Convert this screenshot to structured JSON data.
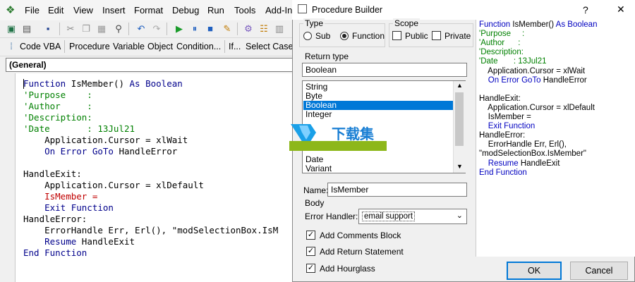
{
  "menubar": [
    "File",
    "Edit",
    "View",
    "Insert",
    "Format",
    "Debug",
    "Run",
    "Tools",
    "Add-In"
  ],
  "toolbar2": {
    "code_vba": "Code VBA",
    "procedure": "Procedure",
    "variable": "Variable",
    "object": "Object",
    "condition": "Condition...",
    "if": "If...",
    "select_case": "Select Case..."
  },
  "object_combo": "(General)",
  "code_lines": [
    {
      "parts": [
        [
          "kw",
          "Function "
        ],
        [
          "bk",
          "IsMember() "
        ],
        [
          "kw",
          "As Boolean"
        ]
      ]
    },
    {
      "parts": [
        [
          "cm",
          "'Purpose    :"
        ]
      ]
    },
    {
      "parts": [
        [
          "cm",
          "'Author     :"
        ]
      ]
    },
    {
      "parts": [
        [
          "cm",
          "'Description:"
        ]
      ]
    },
    {
      "parts": [
        [
          "cm",
          "'Date       : 13Jul21"
        ]
      ]
    },
    {
      "parts": [
        [
          "bk",
          "    Application.Cursor = xlWait"
        ]
      ]
    },
    {
      "parts": [
        [
          "kw",
          "    On Error GoTo "
        ],
        [
          "bk",
          "HandleError"
        ]
      ]
    },
    {
      "parts": [
        [
          "bk",
          ""
        ]
      ]
    },
    {
      "parts": [
        [
          "bk",
          "HandleExit:"
        ]
      ]
    },
    {
      "parts": [
        [
          "bk",
          "    Application.Cursor = xlDefault"
        ]
      ]
    },
    {
      "parts": [
        [
          "rd",
          "    IsMember ="
        ]
      ]
    },
    {
      "parts": [
        [
          "kw",
          "    Exit Function"
        ]
      ]
    },
    {
      "parts": [
        [
          "bk",
          "HandleError:"
        ]
      ]
    },
    {
      "parts": [
        [
          "bk",
          "    ErrorHandle Err, Erl(), \"modSelectionBox.IsM"
        ]
      ]
    },
    {
      "parts": [
        [
          "kw",
          "    Resume "
        ],
        [
          "bk",
          "HandleExit"
        ]
      ]
    },
    {
      "parts": [
        [
          "kw",
          "End Function"
        ]
      ]
    }
  ],
  "dialog": {
    "title": "Procedure Builder",
    "help": "?",
    "close": "✕",
    "type_label": "Type",
    "type_sub": "Sub",
    "type_function": "Function",
    "type_selected": "Function",
    "scope_label": "Scope",
    "scope_public": "Public",
    "scope_private": "Private",
    "return_type_label": "Return type",
    "return_type_value": "Boolean",
    "return_types": [
      "String",
      "Byte",
      "Boolean",
      "Integer",
      "Date",
      "Variant"
    ],
    "return_selected": "Boolean",
    "name_label": "Name:",
    "name_value": "IsMember",
    "body_label": "Body",
    "error_handler_label": "Error Handler:",
    "error_handler_value": "email support",
    "add_comments": "Add Comments Block",
    "add_return": "Add Return Statement",
    "add_hourglass": "Add Hourglass",
    "ok": "OK",
    "cancel": "Cancel"
  },
  "preview_lines": [
    {
      "parts": [
        [
          "k",
          "Function "
        ],
        [
          "b",
          "IsMember() "
        ],
        [
          "k",
          "As Boolean"
        ]
      ]
    },
    {
      "parts": [
        [
          "c",
          "'Purpose     :"
        ]
      ]
    },
    {
      "parts": [
        [
          "c",
          "'Author      :"
        ]
      ]
    },
    {
      "parts": [
        [
          "c",
          "'Description:"
        ]
      ]
    },
    {
      "parts": [
        [
          "c",
          "'Date       : 13Jul21"
        ]
      ]
    },
    {
      "parts": [
        [
          "b",
          "    Application.Cursor = xlWait"
        ]
      ]
    },
    {
      "parts": [
        [
          "k",
          "    On Error GoTo "
        ],
        [
          "b",
          "HandleError"
        ]
      ]
    },
    {
      "parts": [
        [
          "b",
          ""
        ]
      ]
    },
    {
      "parts": [
        [
          "b",
          "HandleExit:"
        ]
      ]
    },
    {
      "parts": [
        [
          "b",
          "    Application.Cursor = xlDefault"
        ]
      ]
    },
    {
      "parts": [
        [
          "b",
          "    IsMember ="
        ]
      ]
    },
    {
      "parts": [
        [
          "k",
          "    Exit Function"
        ]
      ]
    },
    {
      "parts": [
        [
          "b",
          "HandleError:"
        ]
      ]
    },
    {
      "parts": [
        [
          "b",
          "    ErrorHandle Err, Erl(),"
        ]
      ]
    },
    {
      "parts": [
        [
          "b",
          "\"modSelectionBox.IsMember\""
        ]
      ]
    },
    {
      "parts": [
        [
          "k",
          "    Resume "
        ],
        [
          "b",
          "HandleExit"
        ]
      ]
    },
    {
      "parts": [
        [
          "k",
          "End Function"
        ]
      ]
    }
  ],
  "watermark": "下载集",
  "colors": {
    "accent": "#0078d7",
    "keyword": "#00008b",
    "comment": "#008000",
    "error": "#c00000"
  }
}
